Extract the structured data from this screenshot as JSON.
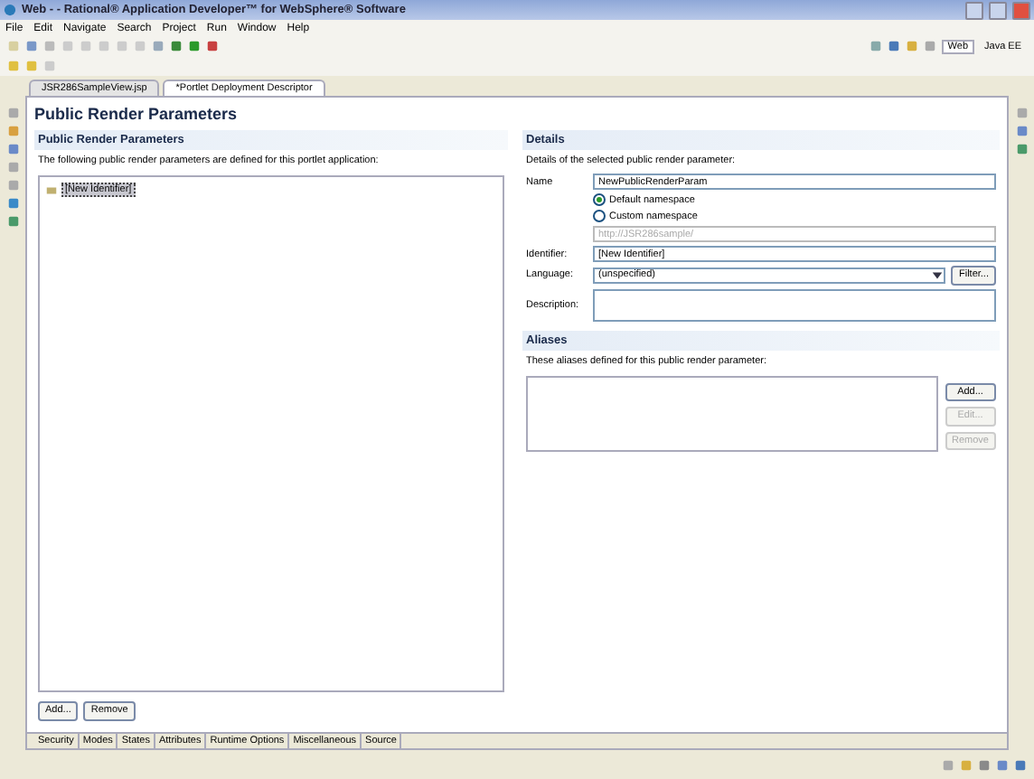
{
  "window": {
    "title": "Web - - Rational® Application Developer™ for WebSphere® Software"
  },
  "menu": [
    "File",
    "Edit",
    "Navigate",
    "Search",
    "Project",
    "Run",
    "Window",
    "Help"
  ],
  "perspectives": [
    {
      "label": "Web",
      "selected": true
    },
    {
      "label": "Java EE",
      "selected": false
    }
  ],
  "editor_tabs": [
    {
      "label": "JSR286SampleView.jsp",
      "selected": false
    },
    {
      "label": "*Portlet Deployment Descriptor",
      "selected": true
    }
  ],
  "page_title": "Public Render Parameters",
  "left_section": {
    "title": "Public Render Parameters",
    "description": "The following public render parameters are defined for this portlet application:",
    "items": [
      {
        "label": "[New Identifier]",
        "selected": true
      }
    ],
    "buttons": [
      "Add...",
      "Remove"
    ]
  },
  "details": {
    "title": "Details",
    "description": "Details of the selected public render parameter:",
    "name_label": "Name",
    "name_value": "NewPublicRenderParam",
    "namespace_options": [
      {
        "label": "Default namespace",
        "selected": true
      },
      {
        "label": "Custom namespace",
        "selected": false
      }
    ],
    "custom_namespace_field": {
      "value": "http://JSR286sample/",
      "disabled": true
    },
    "identifier_label": "Identifier:",
    "identifier_value": "[New Identifier]",
    "language_label": "Language:",
    "language_value": "(unspecified)",
    "filter_button": "Filter...",
    "description_label": "Description:"
  },
  "aliases": {
    "title": "Aliases",
    "description": "These aliases defined for this public render parameter:",
    "buttons": [
      {
        "label": "Add...",
        "disabled": false
      },
      {
        "label": "Edit...",
        "disabled": true
      },
      {
        "label": "Remove",
        "disabled": true
      }
    ]
  },
  "bottom_tabs": [
    {
      "label": "Security",
      "selected": false
    },
    {
      "label": "Modes",
      "selected": false
    },
    {
      "label": "States",
      "selected": false
    },
    {
      "label": "Attributes",
      "selected": false
    },
    {
      "label": "Runtime Options",
      "selected": false
    },
    {
      "label": "Miscellaneous",
      "selected": false
    },
    {
      "label": "Source",
      "selected": false
    }
  ]
}
